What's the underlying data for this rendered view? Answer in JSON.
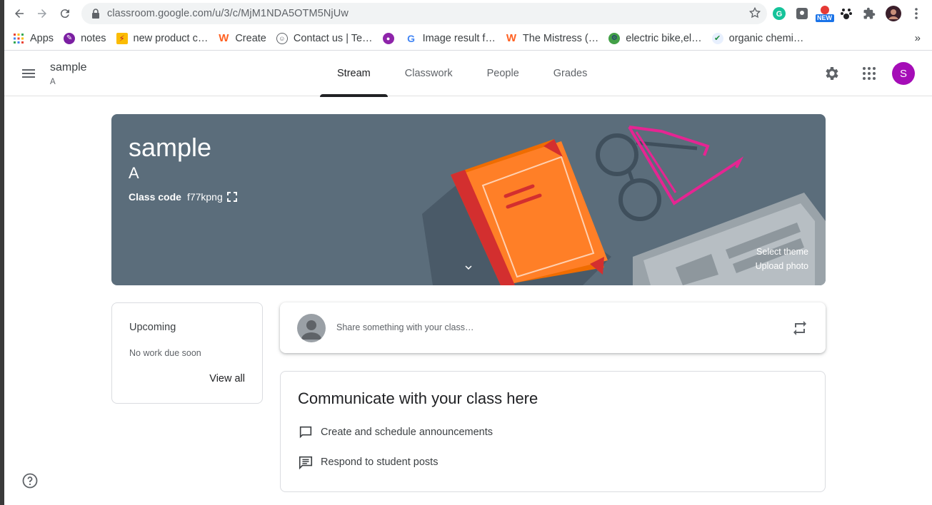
{
  "browser": {
    "url": "classroom.google.com/u/3/c/MjM1NDA5OTM5NjUw",
    "bookmarks": [
      {
        "label": "Apps",
        "icon": "apps-grid-icon"
      },
      {
        "label": "notes",
        "icon": "notes-icon"
      },
      {
        "label": "new product c…",
        "icon": "product-icon"
      },
      {
        "label": "Create",
        "icon": "wattpad-icon"
      },
      {
        "label": "Contact us | Te…",
        "icon": "contact-icon"
      },
      {
        "label": "",
        "icon": "purple-circle-icon"
      },
      {
        "label": "Image result f…",
        "icon": "google-icon"
      },
      {
        "label": "The Mistress (…",
        "icon": "wattpad-icon"
      },
      {
        "label": "electric bike,el…",
        "icon": "bike-icon"
      },
      {
        "label": "organic chemi…",
        "icon": "check-shield-icon"
      }
    ],
    "more_label": "»",
    "new_badge": "NEW"
  },
  "header": {
    "class_name": "sample",
    "section": "A",
    "tabs": [
      {
        "label": "Stream",
        "active": true
      },
      {
        "label": "Classwork",
        "active": false
      },
      {
        "label": "People",
        "active": false
      },
      {
        "label": "Grades",
        "active": false
      }
    ],
    "avatar_initial": "S"
  },
  "banner": {
    "title": "sample",
    "section": "A",
    "class_code_label": "Class code",
    "class_code": "f77kpng",
    "select_theme": "Select theme",
    "upload_photo": "Upload photo",
    "bg_color": "#5b6d7b"
  },
  "upcoming": {
    "title": "Upcoming",
    "empty_text": "No work due soon",
    "view_all": "View all"
  },
  "share": {
    "placeholder": "Share something with your class…"
  },
  "communicate": {
    "title": "Communicate with your class here",
    "items": [
      {
        "label": "Create and schedule announcements",
        "icon": "announcement-icon"
      },
      {
        "label": "Respond to student posts",
        "icon": "comment-icon"
      }
    ]
  },
  "colors": {
    "accent": "#a50db7",
    "tab_active": "#202124"
  }
}
